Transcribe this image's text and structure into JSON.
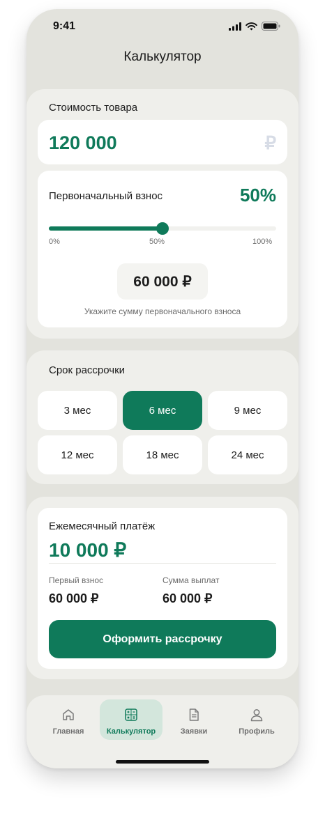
{
  "status": {
    "time": "9:41"
  },
  "header": {
    "title": "Калькулятор"
  },
  "price": {
    "label": "Стоимость товара",
    "value": "120 000",
    "currency": "₽"
  },
  "down_payment": {
    "label": "Первоначальный взнос",
    "percent_label": "50%",
    "percent_value": 50,
    "ticks": [
      "0%",
      "50%",
      "100%"
    ],
    "amount": "60 000 ₽",
    "hint": "Укажите сумму первоначального взноса"
  },
  "term": {
    "label": "Срок рассрочки",
    "options": [
      "3 мес",
      "6 мес",
      "9 мес",
      "12 мес",
      "18 мес",
      "24 мес"
    ],
    "selected": "6 мес"
  },
  "summary": {
    "monthly_label": "Ежемесячный платёж",
    "monthly_value": "10 000 ₽",
    "first_label": "Первый взнос",
    "first_value": "60 000 ₽",
    "total_label": "Сумма выплат",
    "total_value": "60 000 ₽",
    "button": "Оформить рассрочку"
  },
  "tabs": [
    {
      "label": "Главная",
      "icon": "home-icon"
    },
    {
      "label": "Калькулятор",
      "icon": "calculator-icon",
      "active": true
    },
    {
      "label": "Заявки",
      "icon": "document-icon"
    },
    {
      "label": "Профиль",
      "icon": "user-icon"
    }
  ],
  "colors": {
    "accent": "#0f7a5a",
    "background": "#e3e3dd"
  }
}
